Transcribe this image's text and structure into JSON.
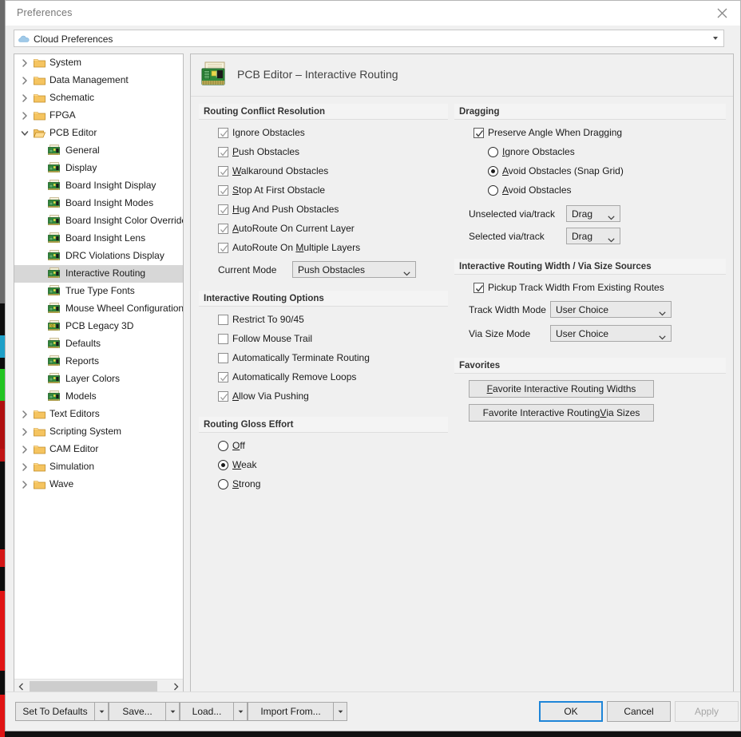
{
  "window": {
    "title": "Preferences",
    "close_icon": "close-icon"
  },
  "profile": {
    "icon": "cloud-icon",
    "value": "Cloud Preferences",
    "arrow_icon": "chevron-down-icon"
  },
  "tree": {
    "items": [
      {
        "label": "System",
        "depth": 0,
        "type": "folder",
        "expanded": false,
        "selected": false
      },
      {
        "label": "Data Management",
        "depth": 0,
        "type": "folder",
        "expanded": false,
        "selected": false
      },
      {
        "label": "Schematic",
        "depth": 0,
        "type": "folder",
        "expanded": false,
        "selected": false
      },
      {
        "label": "FPGA",
        "depth": 0,
        "type": "folder",
        "expanded": false,
        "selected": false
      },
      {
        "label": "PCB Editor",
        "depth": 0,
        "type": "folder",
        "expanded": true,
        "selected": false
      },
      {
        "label": "General",
        "depth": 1,
        "type": "pcb",
        "expanded": null,
        "selected": false
      },
      {
        "label": "Display",
        "depth": 1,
        "type": "pcb",
        "expanded": null,
        "selected": false
      },
      {
        "label": "Board Insight Display",
        "depth": 1,
        "type": "pcb",
        "expanded": null,
        "selected": false
      },
      {
        "label": "Board Insight Modes",
        "depth": 1,
        "type": "pcb",
        "expanded": null,
        "selected": false
      },
      {
        "label": "Board Insight Color Overrides",
        "depth": 1,
        "type": "pcb",
        "expanded": null,
        "selected": false
      },
      {
        "label": "Board Insight Lens",
        "depth": 1,
        "type": "pcb",
        "expanded": null,
        "selected": false
      },
      {
        "label": "DRC Violations Display",
        "depth": 1,
        "type": "pcb",
        "expanded": null,
        "selected": false
      },
      {
        "label": "Interactive Routing",
        "depth": 1,
        "type": "pcb",
        "expanded": null,
        "selected": true
      },
      {
        "label": "True Type Fonts",
        "depth": 1,
        "type": "pcb",
        "expanded": null,
        "selected": false
      },
      {
        "label": "Mouse Wheel Configuration",
        "depth": 1,
        "type": "pcb",
        "expanded": null,
        "selected": false
      },
      {
        "label": "PCB Legacy 3D",
        "depth": 1,
        "type": "pcb3d",
        "expanded": null,
        "selected": false
      },
      {
        "label": "Defaults",
        "depth": 1,
        "type": "pcb",
        "expanded": null,
        "selected": false
      },
      {
        "label": "Reports",
        "depth": 1,
        "type": "pcb",
        "expanded": null,
        "selected": false
      },
      {
        "label": "Layer Colors",
        "depth": 1,
        "type": "pcb",
        "expanded": null,
        "selected": false
      },
      {
        "label": "Models",
        "depth": 1,
        "type": "pcb",
        "expanded": null,
        "selected": false
      },
      {
        "label": "Text Editors",
        "depth": 0,
        "type": "folder",
        "expanded": false,
        "selected": false
      },
      {
        "label": "Scripting System",
        "depth": 0,
        "type": "folder",
        "expanded": false,
        "selected": false
      },
      {
        "label": "CAM Editor",
        "depth": 0,
        "type": "folder",
        "expanded": false,
        "selected": false
      },
      {
        "label": "Simulation",
        "depth": 0,
        "type": "folder",
        "expanded": false,
        "selected": false
      },
      {
        "label": "Wave",
        "depth": 0,
        "type": "folder",
        "expanded": false,
        "selected": false
      }
    ],
    "hscroll": {
      "left_icon": "chevron-left-icon",
      "right_icon": "chevron-right-icon"
    }
  },
  "page": {
    "icon": "pcb-board-icon",
    "title": "PCB Editor – Interactive Routing"
  },
  "routing_conflict_resolution": {
    "heading": "Routing Conflict Resolution",
    "checkboxes": [
      {
        "label": "Ignore Obstacles",
        "accel": "g",
        "checked": true
      },
      {
        "label": "Push Obstacles",
        "accel": "P",
        "checked": true
      },
      {
        "label": "Walkaround Obstacles",
        "accel": "W",
        "checked": true
      },
      {
        "label": "Stop At First Obstacle",
        "accel": "S",
        "checked": true
      },
      {
        "label": "Hug And Push Obstacles",
        "accel": "H",
        "checked": true
      },
      {
        "label": "AutoRoute On Current Layer",
        "accel": "A",
        "checked": true
      },
      {
        "label": "AutoRoute On Multiple Layers",
        "accel": "M",
        "checked": true
      }
    ],
    "current_mode": {
      "label": "Current Mode",
      "value": "Push Obstacles"
    }
  },
  "interactive_routing_options": {
    "heading": "Interactive Routing Options",
    "checkboxes": [
      {
        "label": "Restrict To 90/45",
        "accel": "",
        "checked": false
      },
      {
        "label": "Follow Mouse Trail",
        "accel": "",
        "checked": false
      },
      {
        "label": "Automatically Terminate Routing",
        "accel": "",
        "checked": false
      },
      {
        "label": "Automatically Remove Loops",
        "accel": "",
        "checked": true
      },
      {
        "label": "Allow Via Pushing",
        "accel": "A",
        "checked": true
      }
    ]
  },
  "routing_gloss_effort": {
    "heading": "Routing Gloss Effort",
    "options": [
      {
        "label": "Off",
        "accel": "O",
        "selected": false
      },
      {
        "label": "Weak",
        "accel": "W",
        "selected": true
      },
      {
        "label": "Strong",
        "accel": "S",
        "selected": false
      }
    ]
  },
  "dragging": {
    "heading": "Dragging",
    "preserve_angle": {
      "label": "Preserve Angle When Dragging",
      "checked": true
    },
    "options": [
      {
        "label": "Ignore Obstacles",
        "accel": "I",
        "selected": false
      },
      {
        "label": "Avoid Obstacles (Snap Grid)",
        "accel": "A",
        "selected": true
      },
      {
        "label": "Avoid Obstacles",
        "accel": "A",
        "selected": false
      }
    ],
    "unselected_via_track": {
      "label": "Unselected via/track",
      "value": "Drag"
    },
    "selected_via_track": {
      "label": "Selected via/track",
      "value": "Drag"
    }
  },
  "width_via_sources": {
    "heading": "Interactive Routing Width / Via Size Sources",
    "pickup": {
      "label": "Pickup Track Width From Existing Routes",
      "checked": true
    },
    "track_width_mode": {
      "label": "Track Width Mode",
      "value": "User Choice"
    },
    "via_size_mode": {
      "label": "Via Size Mode",
      "value": "User Choice"
    }
  },
  "favorites": {
    "heading": "Favorites",
    "buttons": [
      {
        "label": "Favorite Interactive Routing Widths",
        "accel": "F"
      },
      {
        "label": "Favorite Interactive Routing Via Sizes",
        "accel": "V"
      }
    ]
  },
  "footer": {
    "split_buttons": [
      {
        "label": "Set To Defaults"
      },
      {
        "label": "Save..."
      },
      {
        "label": "Load..."
      },
      {
        "label": "Import From..."
      }
    ],
    "ok": "OK",
    "cancel": "Cancel",
    "apply": "Apply"
  },
  "colors": {
    "accent": "#1e85d8",
    "selection": "#d7d7d7",
    "dialog_bg": "#f0f0f0",
    "section_head_bg": "#f4f4f4"
  }
}
